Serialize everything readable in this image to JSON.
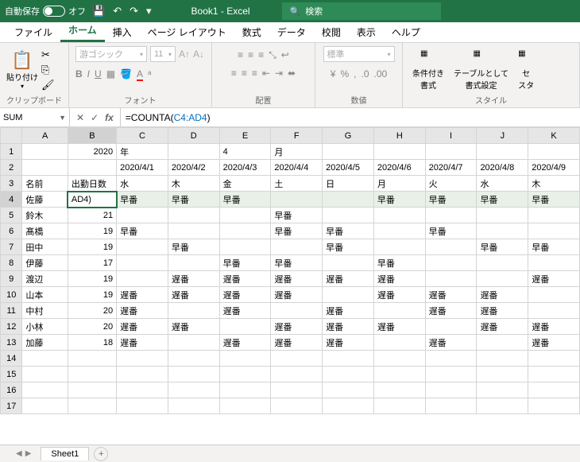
{
  "titlebar": {
    "autosave": "自動保存",
    "autosave_state": "オフ",
    "title": "Book1 - Excel",
    "search_placeholder": "検索"
  },
  "tabs": [
    "ファイル",
    "ホーム",
    "挿入",
    "ページ レイアウト",
    "数式",
    "データ",
    "校閲",
    "表示",
    "ヘルプ"
  ],
  "active_tab": 1,
  "ribbon": {
    "clipboard": {
      "paste": "貼り付け",
      "label": "クリップボード"
    },
    "font": {
      "name": "游ゴシック",
      "size": "11",
      "label": "フォント"
    },
    "align": {
      "label": "配置"
    },
    "number": {
      "format": "標準",
      "label": "数値"
    },
    "style": {
      "cond": "条件付き\n書式",
      "table": "テーブルとして\n書式設定",
      "cell": "セ\nスタ",
      "label": "スタイル"
    }
  },
  "namebox": "SUM",
  "formula": {
    "prefix": "=COUNTA(",
    "ref": "C4:AD4",
    "suffix": ")"
  },
  "columns": [
    "A",
    "B",
    "C",
    "D",
    "E",
    "F",
    "G",
    "H",
    "I",
    "J",
    "K"
  ],
  "grid": {
    "r1": [
      "",
      "2020",
      "年",
      "",
      "4",
      "月",
      "",
      "",
      "",
      "",
      ""
    ],
    "r2": [
      "",
      "",
      "2020/4/1",
      "2020/4/2",
      "2020/4/3",
      "2020/4/4",
      "2020/4/5",
      "2020/4/6",
      "2020/4/7",
      "2020/4/8",
      "2020/4/9"
    ],
    "r3": [
      "名前",
      "出勤日数",
      "水",
      "木",
      "金",
      "土",
      "日",
      "月",
      "火",
      "水",
      "木"
    ],
    "r4": [
      "佐藤",
      "AD4)",
      "早番",
      "早番",
      "早番",
      "",
      "",
      "早番",
      "早番",
      "早番",
      "早番"
    ],
    "r5": [
      "鈴木",
      "21",
      "",
      "",
      "",
      "早番",
      "",
      "",
      "",
      "",
      ""
    ],
    "r6": [
      "髙橋",
      "19",
      "早番",
      "",
      "",
      "早番",
      "早番",
      "",
      "早番",
      "",
      ""
    ],
    "r7": [
      "田中",
      "19",
      "",
      "早番",
      "",
      "",
      "早番",
      "",
      "",
      "早番",
      "早番"
    ],
    "r8": [
      "伊藤",
      "17",
      "",
      "",
      "早番",
      "早番",
      "",
      "早番",
      "",
      "",
      ""
    ],
    "r9": [
      "渡辺",
      "19",
      "",
      "遅番",
      "遅番",
      "遅番",
      "遅番",
      "遅番",
      "",
      "",
      "遅番"
    ],
    "r10": [
      "山本",
      "19",
      "遅番",
      "遅番",
      "遅番",
      "遅番",
      "",
      "遅番",
      "遅番",
      "遅番",
      ""
    ],
    "r11": [
      "中村",
      "20",
      "遅番",
      "",
      "遅番",
      "",
      "遅番",
      "",
      "遅番",
      "遅番",
      ""
    ],
    "r12": [
      "小林",
      "20",
      "遅番",
      "遅番",
      "",
      "遅番",
      "遅番",
      "遅番",
      "",
      "遅番",
      "遅番"
    ],
    "r13": [
      "加藤",
      "18",
      "遅番",
      "",
      "遅番",
      "遅番",
      "遅番",
      "",
      "遅番",
      "",
      "遅番"
    ],
    "r14": [
      "",
      "",
      "",
      "",
      "",
      "",
      "",
      "",
      "",
      "",
      ""
    ],
    "r15": [
      "",
      "",
      "",
      "",
      "",
      "",
      "",
      "",
      "",
      "",
      ""
    ],
    "r16": [
      "",
      "",
      "",
      "",
      "",
      "",
      "",
      "",
      "",
      "",
      ""
    ],
    "r17": [
      "",
      "",
      "",
      "",
      "",
      "",
      "",
      "",
      "",
      "",
      ""
    ]
  },
  "sheettab": "Sheet1"
}
